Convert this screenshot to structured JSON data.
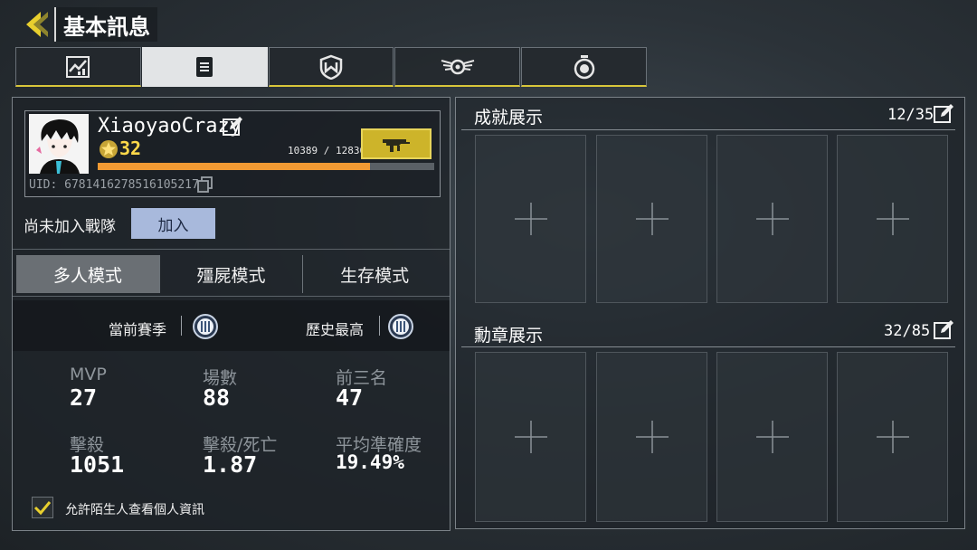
{
  "header": {
    "title": "基本訊息"
  },
  "tabs": [
    {
      "icon": "stats-chart-icon",
      "active": false
    },
    {
      "icon": "document-icon",
      "active": true
    },
    {
      "icon": "shield-badge-icon",
      "active": false
    },
    {
      "icon": "wings-emblem-icon",
      "active": false
    },
    {
      "icon": "stopwatch-icon",
      "active": false
    }
  ],
  "profile": {
    "username": "XiaoyaoCrazy",
    "level": "32",
    "xp_text": "10389 / 12830",
    "xp_progress": 0.81,
    "uid": "UID: 6781416278516105217"
  },
  "clan": {
    "status": "尚未加入戰隊",
    "join_label": "加入"
  },
  "modes": [
    "多人模式",
    "殭屍模式",
    "生存模式"
  ],
  "season": {
    "current_label": "當前賽季",
    "history_label": "歷史最高"
  },
  "stats": [
    {
      "label": "MVP",
      "value": "27"
    },
    {
      "label": "場數",
      "value": "88"
    },
    {
      "label": "前三名",
      "value": "47"
    },
    {
      "label": "擊殺",
      "value": "1051"
    },
    {
      "label": "擊殺/死亡",
      "value": "1.87"
    },
    {
      "label": "平均準確度",
      "value": "19.49%"
    }
  ],
  "privacy": {
    "label": "允許陌生人查看個人資訊",
    "checked": true
  },
  "achievements": {
    "title": "成就展示",
    "count": "12/35"
  },
  "medals": {
    "title": "勳章展示",
    "count": "32/85"
  },
  "colors": {
    "accent": "#d9c63a",
    "xp": "#f29a33",
    "level": "#ffd94a",
    "join": "#a8b9dc"
  }
}
